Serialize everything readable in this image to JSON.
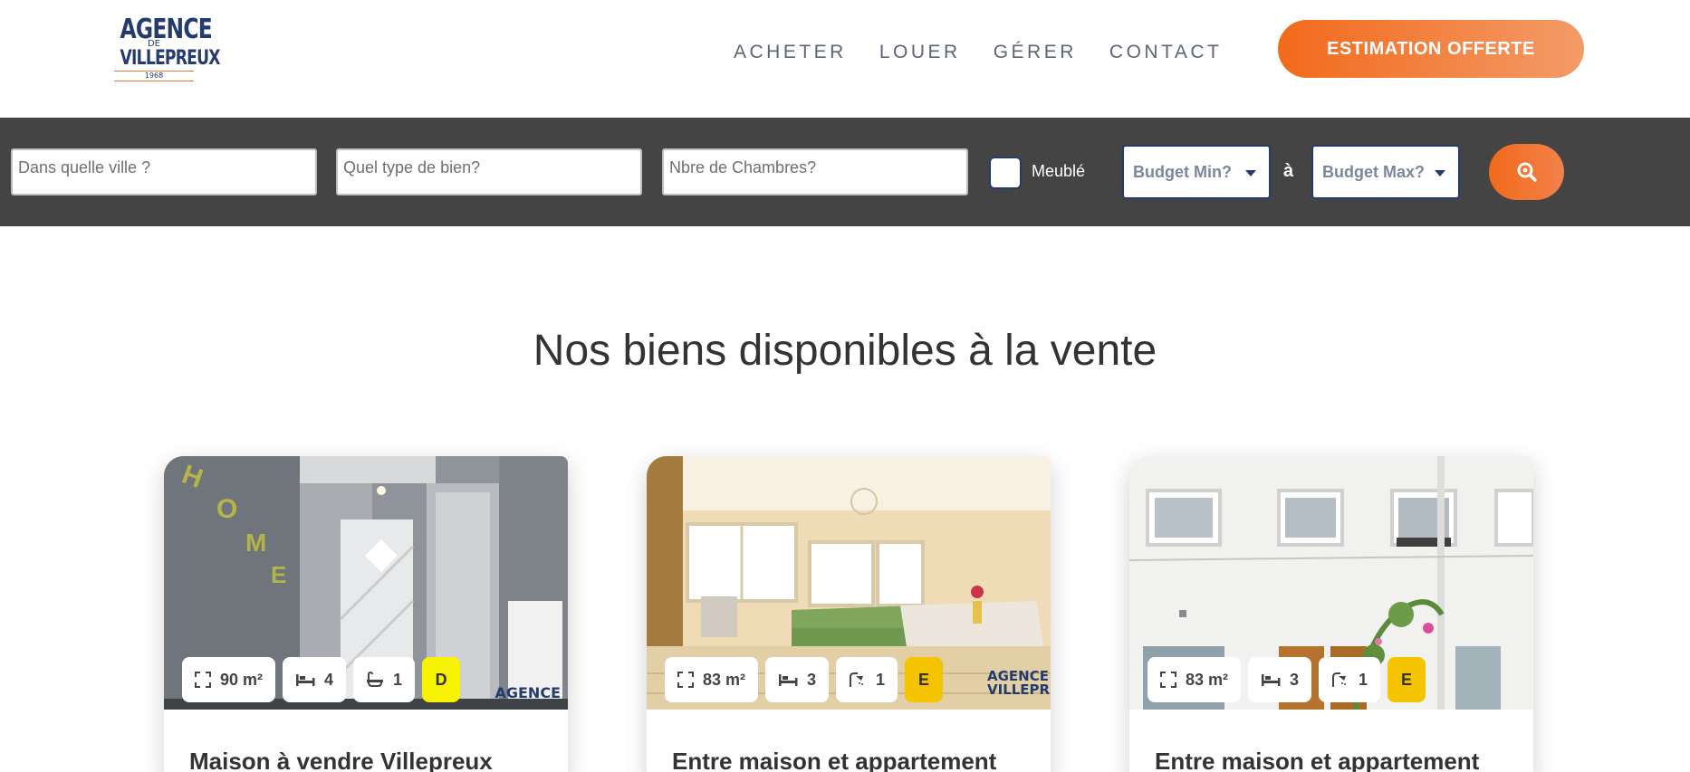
{
  "header": {
    "logo_line1": "AGENCE",
    "logo_line2": "DE",
    "logo_line3": "VILLEPREUX",
    "logo_year": "1968",
    "nav": [
      "ACHETER",
      "LOUER",
      "GÉRER",
      "CONTACT"
    ],
    "cta_label": "ESTIMATION OFFERTE"
  },
  "search": {
    "city_placeholder": "Dans quelle ville ?",
    "type_placeholder": "Quel type de bien?",
    "rooms_placeholder": "Nbre de Chambres?",
    "furnished_label": "Meublé",
    "budget_min": "Budget Min?",
    "between_label": "à",
    "budget_max": "Budget Max?",
    "search_icon": "search-icon"
  },
  "main": {
    "title": "Nos biens disponibles à la vente"
  },
  "cards": [
    {
      "area": "90 m²",
      "bedrooms": "4",
      "bathrooms": "1",
      "dpe": "D",
      "dpe_color": "#f7f200",
      "title": "Maison à vendre Villepreux",
      "watermark": "AGENCE"
    },
    {
      "area": "83 m²",
      "bedrooms": "3",
      "bathrooms": "1",
      "dpe": "E",
      "dpe_color": "#f5c400",
      "title": "Entre maison et appartement",
      "watermark": "AGENCE VILLEPREUX"
    },
    {
      "area": "83 m²",
      "bedrooms": "3",
      "bathrooms": "1",
      "dpe": "E",
      "dpe_color": "#f5c400",
      "title": "Entre maison et appartement"
    }
  ],
  "colors": {
    "accent": "#f26a1b",
    "brand": "#243b6e",
    "searchbar": "#444444"
  }
}
